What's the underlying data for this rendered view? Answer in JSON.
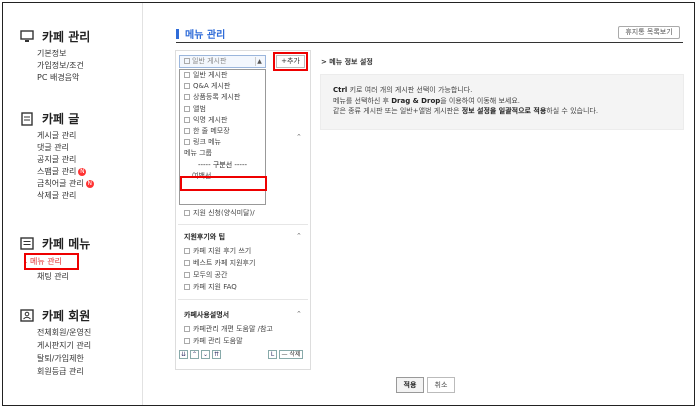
{
  "sidebar": {
    "sections": [
      {
        "title": "카페 관리",
        "items": [
          "기본정보",
          "가입정보/조건",
          "PC 배경음악"
        ]
      },
      {
        "title": "카페 글",
        "items": [
          "게시글 관리",
          "댓글 관리",
          "공지글 관리",
          "스팸글 관리",
          "금칙어글 관리",
          "삭제글 관리"
        ]
      },
      {
        "title": "카페 메뉴",
        "items": [
          "메뉴 관리",
          "채팅 관리"
        ]
      },
      {
        "title": "카페 회원",
        "items": [
          "전체회원/운영진",
          "게시판지기 관리",
          "탈퇴/가입제한",
          "회원등급 관리"
        ]
      }
    ],
    "new_badge": "N",
    "active_marker": "▸"
  },
  "main": {
    "title": "메뉴 관리",
    "recycle_button": "휴지통 목록보기",
    "menu_select": {
      "value": "일반 게시판",
      "caret": "▲"
    },
    "add_button": "+추가",
    "dropdown_options": [
      "일반 게시판",
      "Q&A 게시판",
      "상품등록 게시판",
      "앨범",
      "익명 게시판",
      "한 줄 메모장",
      "링크 메뉴",
      "메뉴 그룹",
      "----- 구분선 -----",
      "여백선"
    ],
    "tree": {
      "item_behind": "지원 신청(양식미달)/",
      "groups": [
        {
          "title": "지원후기와 팁",
          "items": [
            "카페 지원 후기 쓰기",
            "베스트 카페 지원후기",
            "모두의 공간",
            "카페 지원 FAQ"
          ]
        },
        {
          "title": "카페사용설명서",
          "items": [
            "카페관리 개편 도움말 /참고",
            "카페 관리 도움말"
          ]
        }
      ],
      "collapse_caret": "⌃",
      "move_buttons": [
        "⇊",
        "⌃",
        "⌄",
        "⇈"
      ],
      "l_button": "L",
      "delete_button": "— 삭제"
    },
    "info": {
      "title": "> 메뉴 정보 설정",
      "lines": [
        {
          "b": "Ctrl",
          "t": " 키로 여러 개의 게시판 선택이 가능합니다."
        },
        {
          "t": "메뉴를 선택하신 후 ",
          "b": "Drag & Drop",
          "t2": "을 이용하여 이동해 보세요."
        },
        {
          "t": "같은 종류 게시판 또는 일반+앨범 게시판은 ",
          "b": "정보 설정을 일괄적으로 적용",
          "t2": "하실 수 있습니다."
        }
      ]
    },
    "apply_button": "적용",
    "cancel_button": "취소"
  }
}
